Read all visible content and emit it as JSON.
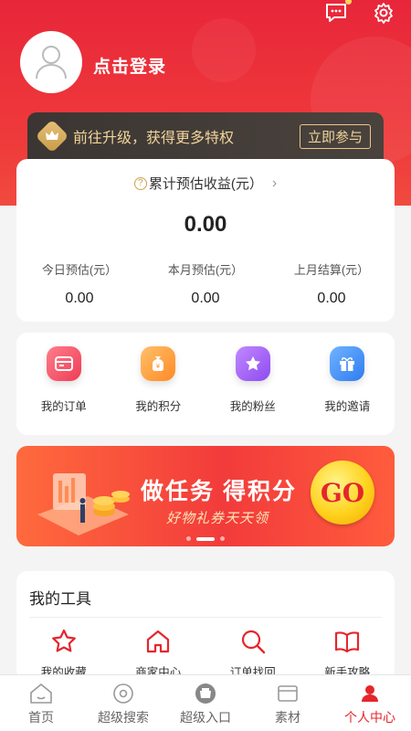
{
  "header": {
    "login_text": "点击登录",
    "message_icon": "chat-bubble-icon",
    "settings_icon": "gear-icon"
  },
  "vip": {
    "text": "前往升级，获得更多特权",
    "button": "立即参与"
  },
  "earnings": {
    "title": "累计预估收益(元）",
    "total": "0.00",
    "columns": [
      {
        "label": "今日预估(元）",
        "value": "0.00"
      },
      {
        "label": "本月预估(元）",
        "value": "0.00"
      },
      {
        "label": "上月结算(元）",
        "value": "0.00"
      }
    ]
  },
  "quick_links": [
    {
      "label": "我的订单",
      "icon": "order-card-icon",
      "color": "#f04d62"
    },
    {
      "label": "我的积分",
      "icon": "money-bag-icon",
      "color": "#ff9a2e"
    },
    {
      "label": "我的粉丝",
      "icon": "star-icon",
      "color": "#9b59f0"
    },
    {
      "label": "我的邀请",
      "icon": "gift-icon",
      "color": "#3d8ef5"
    }
  ],
  "banner": {
    "title": "做任务 得积分",
    "subtitle": "好物礼券天天领",
    "go": "GO"
  },
  "tools": {
    "title": "我的工具",
    "items": [
      {
        "label": "我的收藏",
        "icon": "star-outline-icon"
      },
      {
        "label": "商家中心",
        "icon": "store-icon"
      },
      {
        "label": "订单找回",
        "icon": "search-icon"
      },
      {
        "label": "新手攻略",
        "icon": "book-icon"
      }
    ]
  },
  "tabbar": [
    {
      "label": "首页",
      "icon": "home-icon",
      "active": false
    },
    {
      "label": "超级搜索",
      "icon": "super-search-icon",
      "active": false
    },
    {
      "label": "超级入口",
      "icon": "entrance-icon",
      "active": false
    },
    {
      "label": "素材",
      "icon": "material-icon",
      "active": false
    },
    {
      "label": "个人中心",
      "icon": "profile-icon",
      "active": true
    }
  ],
  "colors": {
    "brand_red": "#e5262c",
    "vip_gold": "#f1d59a"
  }
}
